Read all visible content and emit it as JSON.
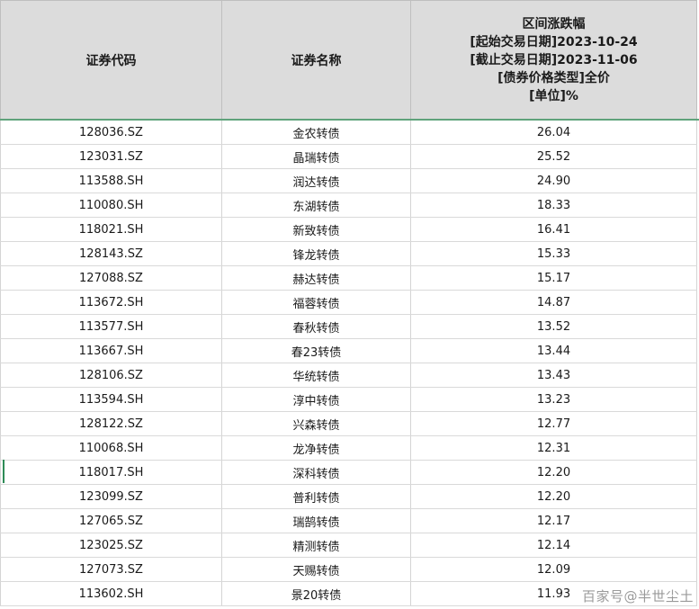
{
  "header": {
    "col_code": "证券代码",
    "col_name": "证券名称",
    "col_change": {
      "line1": "区间涨跌幅",
      "line2": "[起始交易日期]2023-10-24",
      "line3": "[截止交易日期]2023-11-06",
      "line4": "[债券价格类型]全价",
      "line5": "[单位]%"
    }
  },
  "rows": [
    {
      "code": "128036.SZ",
      "name": "金农转债",
      "change": "26.04"
    },
    {
      "code": "123031.SZ",
      "name": "晶瑞转债",
      "change": "25.52"
    },
    {
      "code": "113588.SH",
      "name": "润达转债",
      "change": "24.90"
    },
    {
      "code": "110080.SH",
      "name": "东湖转债",
      "change": "18.33"
    },
    {
      "code": "118021.SH",
      "name": "新致转债",
      "change": "16.41"
    },
    {
      "code": "128143.SZ",
      "name": "锋龙转债",
      "change": "15.33"
    },
    {
      "code": "127088.SZ",
      "name": "赫达转债",
      "change": "15.17"
    },
    {
      "code": "113672.SH",
      "name": "福蓉转债",
      "change": "14.87"
    },
    {
      "code": "113577.SH",
      "name": "春秋转债",
      "change": "13.52"
    },
    {
      "code": "113667.SH",
      "name": "春23转债",
      "change": "13.44"
    },
    {
      "code": "128106.SZ",
      "name": "华统转债",
      "change": "13.43"
    },
    {
      "code": "113594.SH",
      "name": "淳中转债",
      "change": "13.23"
    },
    {
      "code": "128122.SZ",
      "name": "兴森转债",
      "change": "12.77"
    },
    {
      "code": "110068.SH",
      "name": "龙净转债",
      "change": "12.31"
    },
    {
      "code": "118017.SH",
      "name": "深科转债",
      "change": "12.20"
    },
    {
      "code": "123099.SZ",
      "name": "普利转债",
      "change": "12.20"
    },
    {
      "code": "127065.SZ",
      "name": "瑞鹄转债",
      "change": "12.17"
    },
    {
      "code": "123025.SZ",
      "name": "精测转债",
      "change": "12.14"
    },
    {
      "code": "127073.SZ",
      "name": "天赐转债",
      "change": "12.09"
    },
    {
      "code": "113602.SH",
      "name": "景20转债",
      "change": "11.93"
    }
  ],
  "watermark": "百家号@半世尘土"
}
